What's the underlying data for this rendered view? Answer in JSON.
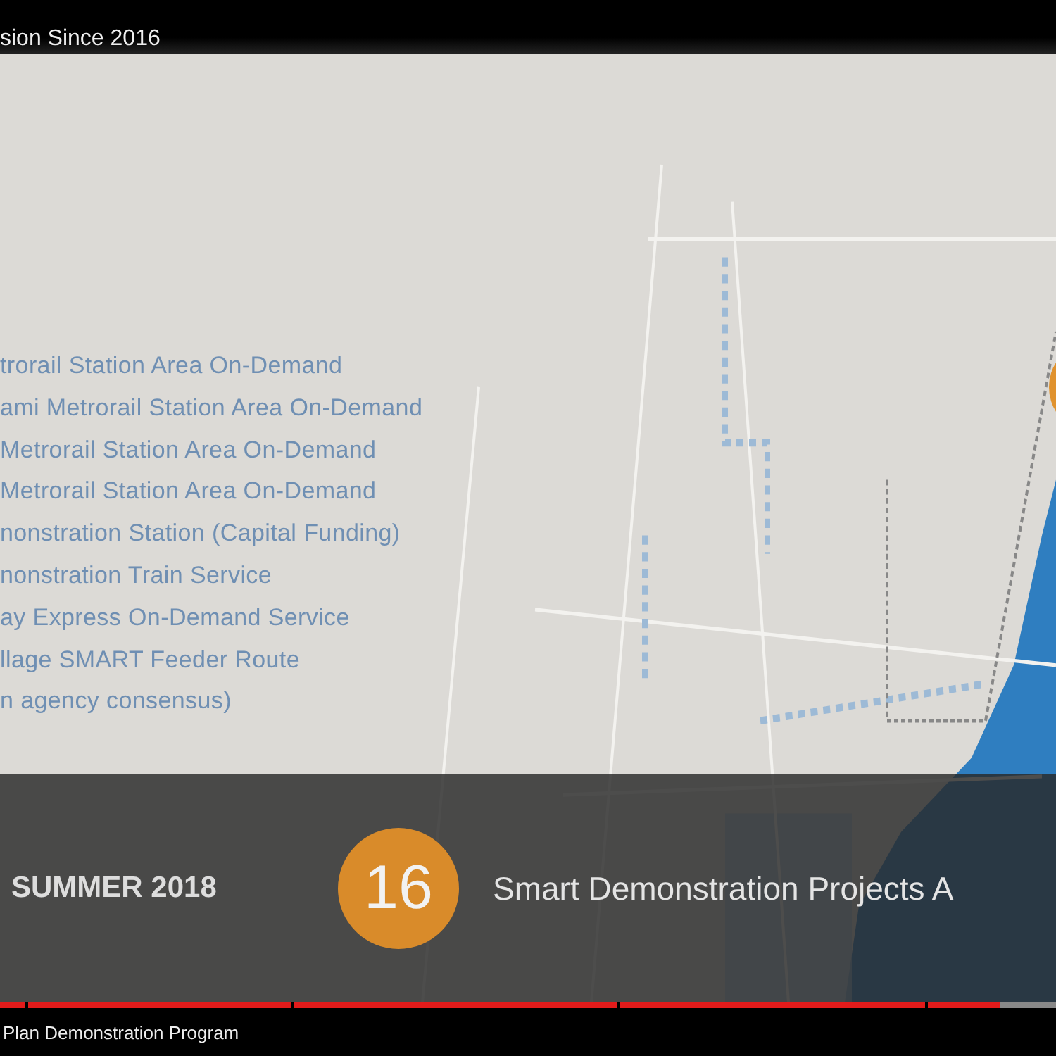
{
  "video_title": "sion Since 2016",
  "project_list": [
    "trorail Station Area On-Demand",
    "ami Metrorail Station Area On-Demand",
    "Metrorail Station Area On-Demand",
    "Metrorail Station Area On-Demand",
    "nonstration Station (Capital Funding)",
    "nonstration Train Service",
    "ay Express On-Demand Service",
    "llage SMART Feeder Route",
    "n agency consensus)"
  ],
  "banner": {
    "date": "SUMMER 2018",
    "count": "16",
    "caption": "Smart Demonstration Projects A"
  },
  "progress": {
    "level": 0.947
  },
  "chapter_title": "Plan Demonstration Program"
}
